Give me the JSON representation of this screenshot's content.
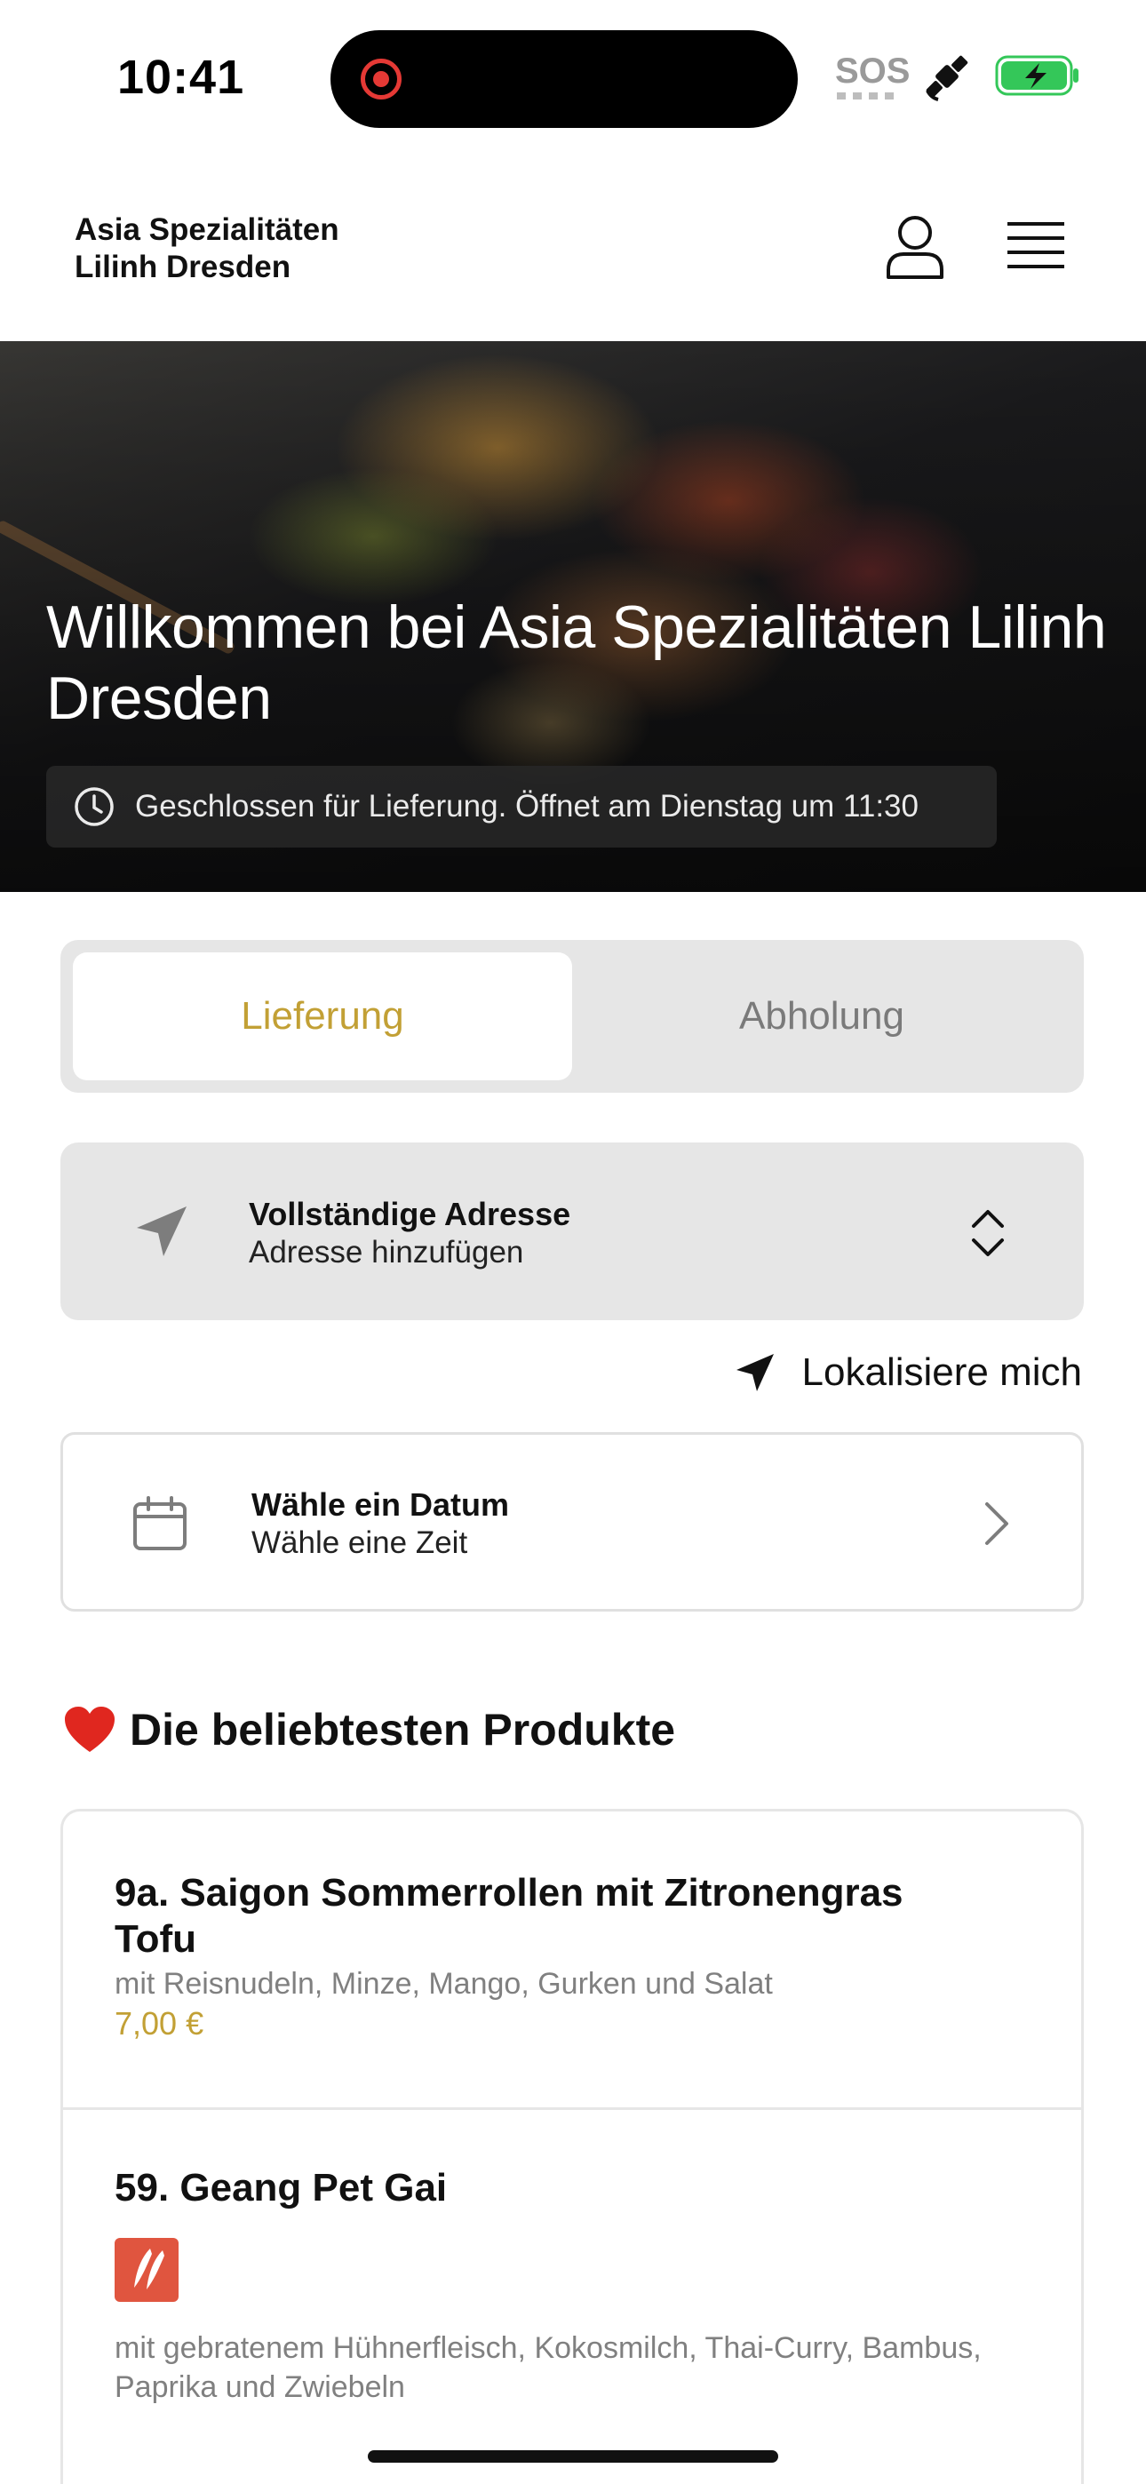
{
  "status_bar": {
    "time": "10:41",
    "carrier_text": "SOS",
    "icons": [
      "screen-recording-icon",
      "satellite-icon",
      "battery-charging-icon"
    ],
    "battery_color": "#34c759"
  },
  "header": {
    "brand_line1": "Asia Spezialitäten",
    "brand_line2": "Lilinh Dresden",
    "icons": [
      "user-icon",
      "menu-icon"
    ]
  },
  "hero": {
    "title": "Willkommen bei Asia Spezialitäten Lilinh Dresden",
    "status": "Geschlossen für Lieferung. Öffnet am Dienstag um 11:30"
  },
  "order_mode": {
    "tabs": [
      {
        "label": "Lieferung",
        "active": true
      },
      {
        "label": "Abholung",
        "active": false
      }
    ]
  },
  "address": {
    "title": "Vollständige Adresse",
    "subtitle": "Adresse hinzufügen"
  },
  "locate": {
    "label": "Lokalisiere mich"
  },
  "date": {
    "title": "Wähle ein Datum",
    "subtitle": "Wähle eine Zeit"
  },
  "popular": {
    "title": "Die beliebtesten Produkte",
    "products": [
      {
        "name": "9a. Saigon Sommerrollen mit Zitronengras Tofu",
        "description": "mit Reisnudeln, Minze, Mango, Gurken und Salat",
        "price": "7,00 €"
      },
      {
        "name": "59. Geang Pet Gai",
        "description": "mit gebratenem Hühnerfleisch, Kokosmilch, Thai-Curry, Bambus, Paprika und Zwiebeln",
        "spicy": true
      }
    ]
  },
  "colors": {
    "accent": "#c2a035",
    "panel": "#e6e6e6",
    "spicy": "#e0553f"
  }
}
